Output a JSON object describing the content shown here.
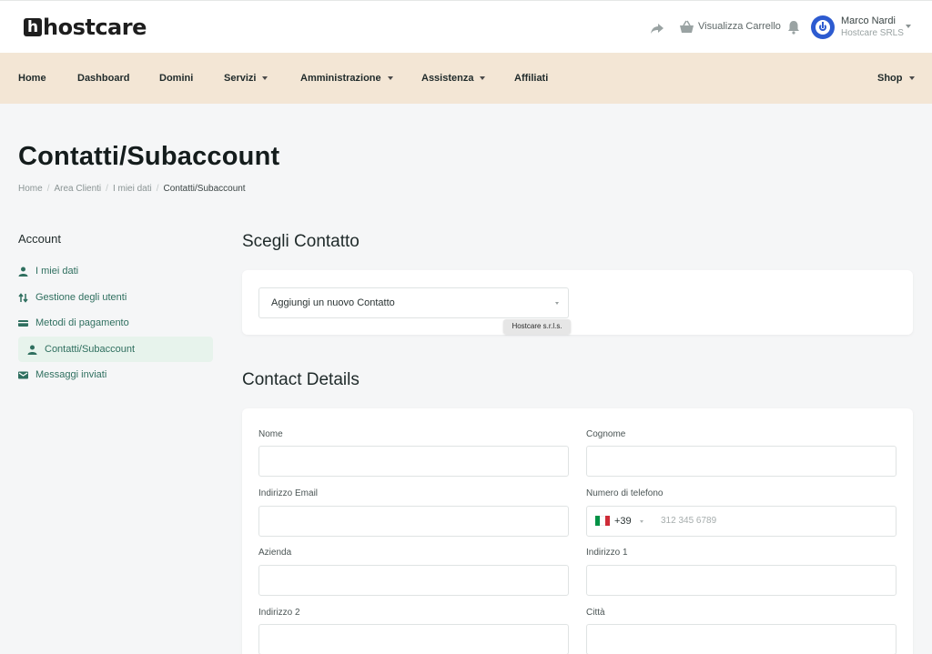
{
  "header": {
    "logo_mark": "h",
    "logo_text": "hostcare",
    "cart_label": "Visualizza Carrello",
    "user_name": "Marco Nardi",
    "user_company": "Hostcare SRLS"
  },
  "nav": {
    "items": [
      {
        "label": "Home",
        "dropdown": false
      },
      {
        "label": "Dashboard",
        "dropdown": false
      },
      {
        "label": "Domini",
        "dropdown": false
      },
      {
        "label": "Servizi",
        "dropdown": true
      },
      {
        "label": "Amministrazione",
        "dropdown": true
      },
      {
        "label": "Assistenza",
        "dropdown": true
      },
      {
        "label": "Affiliati",
        "dropdown": false
      }
    ],
    "shop": {
      "label": "Shop",
      "dropdown": true
    }
  },
  "page": {
    "title": "Contatti/Subaccount",
    "breadcrumb": [
      "Home",
      "Area Clienti",
      "I miei dati",
      "Contatti/Subaccount"
    ],
    "breadcrumb_separator": "/"
  },
  "sidebar": {
    "title": "Account",
    "items": [
      {
        "label": "I miei dati",
        "icon": "user-icon",
        "active": false
      },
      {
        "label": "Gestione degli utenti",
        "icon": "swap-icon",
        "active": false
      },
      {
        "label": "Metodi di pagamento",
        "icon": "credit-card-icon",
        "active": false
      },
      {
        "label": "Contatti/Subaccount",
        "icon": "user-icon",
        "active": true
      },
      {
        "label": "Messaggi inviati",
        "icon": "inbox-icon",
        "active": false
      }
    ]
  },
  "choose_contact": {
    "title": "Scegli Contatto",
    "selected": "Aggiungi un nuovo Contatto",
    "tooltip": "Hostcare s.r.l.s."
  },
  "contact_details": {
    "title": "Contact Details",
    "fields": {
      "nome": "Nome",
      "cognome": "Cognome",
      "email": "Indirizzo Email",
      "telefono": "Numero di telefono",
      "azienda": "Azienda",
      "indirizzo1": "Indirizzo 1",
      "indirizzo2": "Indirizzo 2",
      "citta": "Città"
    },
    "phone": {
      "country_code": "+39",
      "placeholder": "312 345 6789",
      "flag_colors": [
        "#009246",
        "#ffffff",
        "#ce2b37"
      ]
    }
  },
  "colors": {
    "nav_bg": "#f3e6d5",
    "accent": "#2f6f5f",
    "active_bg": "#e7f3ec",
    "avatar": "#2d5bd0"
  }
}
